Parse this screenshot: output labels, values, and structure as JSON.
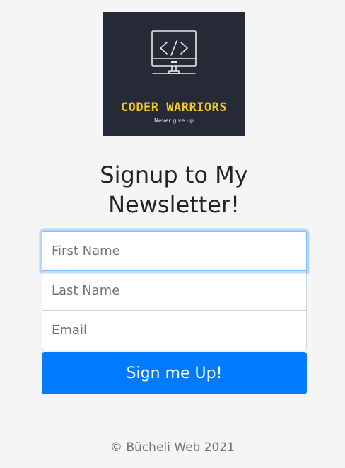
{
  "logo": {
    "icon": "code-monitor-icon",
    "brand": "CODER WARRIORS",
    "tagline": "Never give up",
    "background_color": "#252a36",
    "brand_color": "#f2c62a"
  },
  "heading": "Signup to My Newsletter!",
  "form": {
    "first_name_placeholder": "First Name",
    "last_name_placeholder": "Last Name",
    "email_placeholder": "Email",
    "submit_label": "Sign me Up!"
  },
  "footer": "© Bücheli Web 2021",
  "colors": {
    "page_background": "#f5f5f5",
    "primary": "#007bff",
    "focus_border": "#80bdff"
  }
}
